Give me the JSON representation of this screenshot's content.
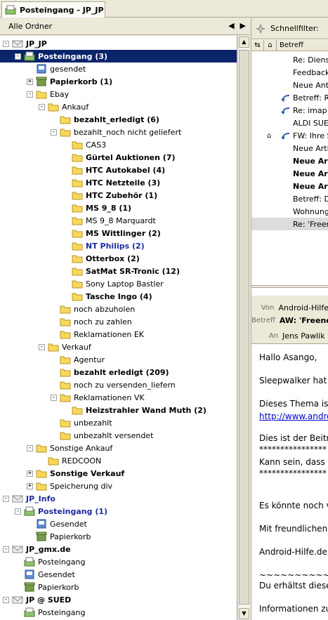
{
  "tab": {
    "title": "Posteingang - JP_JP"
  },
  "folder_pane": {
    "header": "Alle Ordner",
    "prev_arrow": "◀",
    "next_arrow": "▶"
  },
  "tree": [
    {
      "label": "JP_JP",
      "bold": true,
      "toggle": "-",
      "icon": "account-icon",
      "indent": 0
    },
    {
      "label": "Posteingang (3)",
      "bold": true,
      "toggle": "-",
      "icon": "inbox-icon",
      "indent": 1,
      "selected": true
    },
    {
      "label": "gesendet",
      "toggle": "",
      "icon": "sent-icon",
      "indent": 2
    },
    {
      "label": "Papierkorb (1)",
      "bold": true,
      "toggle": "+",
      "icon": "trash-icon",
      "indent": 2
    },
    {
      "label": "Ebay",
      "toggle": "-",
      "icon": "folder-icon",
      "indent": 2
    },
    {
      "label": "Ankauf",
      "toggle": "-",
      "icon": "folder-icon",
      "indent": 3
    },
    {
      "label": "bezahlt_erledigt (6)",
      "bold": true,
      "toggle": "",
      "icon": "folder-icon",
      "indent": 4
    },
    {
      "label": "bezahlt_noch nicht geliefert",
      "toggle": "-",
      "icon": "folder-icon",
      "indent": 4
    },
    {
      "label": "CAS3",
      "toggle": "",
      "icon": "folder-icon",
      "indent": 5
    },
    {
      "label": "Gürtel Auktionen (7)",
      "bold": true,
      "toggle": "",
      "icon": "folder-icon",
      "indent": 5
    },
    {
      "label": "HTC Autokabel (4)",
      "bold": true,
      "toggle": "",
      "icon": "folder-icon",
      "indent": 5
    },
    {
      "label": "HTC Netzteile (3)",
      "bold": true,
      "toggle": "",
      "icon": "folder-icon",
      "indent": 5
    },
    {
      "label": "HTC Zubehör (1)",
      "bold": true,
      "toggle": "",
      "icon": "folder-icon",
      "indent": 5
    },
    {
      "label": "MS 9_8 (1)",
      "bold": true,
      "toggle": "",
      "icon": "folder-icon",
      "indent": 5
    },
    {
      "label": "MS 9_8 Marquardt",
      "toggle": "",
      "icon": "folder-icon",
      "indent": 5
    },
    {
      "label": "MS Wittlinger (2)",
      "bold": true,
      "toggle": "",
      "icon": "folder-icon",
      "indent": 5
    },
    {
      "label": "NT Philips (2)",
      "bold": true,
      "blue": true,
      "toggle": "",
      "icon": "folder-icon",
      "indent": 5
    },
    {
      "label": "Otterbox (2)",
      "bold": true,
      "toggle": "",
      "icon": "folder-icon",
      "indent": 5
    },
    {
      "label": "SatMat SR-Tronic (12)",
      "bold": true,
      "toggle": "",
      "icon": "folder-icon",
      "indent": 5
    },
    {
      "label": "Sony Laptop Bastler",
      "toggle": "",
      "icon": "folder-icon",
      "indent": 5
    },
    {
      "label": "Tasche Ingo (4)",
      "bold": true,
      "toggle": "",
      "icon": "folder-icon",
      "indent": 5
    },
    {
      "label": "noch abzuholen",
      "toggle": "",
      "icon": "folder-icon",
      "indent": 4
    },
    {
      "label": "noch zu zahlen",
      "toggle": "",
      "icon": "folder-icon",
      "indent": 4
    },
    {
      "label": "Reklamationen EK",
      "toggle": "",
      "icon": "folder-icon",
      "indent": 4
    },
    {
      "label": "Verkauf",
      "toggle": "-",
      "icon": "folder-icon",
      "indent": 3
    },
    {
      "label": "Agentur",
      "toggle": "",
      "icon": "folder-icon",
      "indent": 4
    },
    {
      "label": "bezahlt erledigt (209)",
      "bold": true,
      "toggle": "",
      "icon": "folder-icon",
      "indent": 4
    },
    {
      "label": "noch zu versenden_liefern",
      "toggle": "",
      "icon": "folder-icon",
      "indent": 4
    },
    {
      "label": "Reklamationen VK",
      "toggle": "-",
      "icon": "folder-icon",
      "indent": 4
    },
    {
      "label": "Heizstrahler Wand Muth (2)",
      "bold": true,
      "toggle": "",
      "icon": "folder-icon",
      "indent": 5
    },
    {
      "label": "unbezahlt",
      "toggle": "",
      "icon": "folder-icon",
      "indent": 4
    },
    {
      "label": "unbezahlt versendet",
      "toggle": "",
      "icon": "folder-icon",
      "indent": 4
    },
    {
      "label": "Sonstige Ankauf",
      "toggle": "-",
      "icon": "folder-icon",
      "indent": 2
    },
    {
      "label": "REDCOON",
      "toggle": "",
      "icon": "folder-icon",
      "indent": 3
    },
    {
      "label": "Sonstige Verkauf",
      "bold": true,
      "toggle": "+",
      "icon": "folder-icon",
      "indent": 2
    },
    {
      "label": "Speicherung div",
      "toggle": "+",
      "icon": "folder-icon",
      "indent": 2
    },
    {
      "label": "JP_Info",
      "bold": true,
      "blue": true,
      "toggle": "-",
      "icon": "account-icon",
      "indent": 0
    },
    {
      "label": "Posteingang (1)",
      "bold": true,
      "blue": true,
      "toggle": "-",
      "icon": "inbox-icon",
      "indent": 1
    },
    {
      "label": "Gesendet",
      "toggle": "",
      "icon": "sent-icon",
      "indent": 2
    },
    {
      "label": "Papierkorb",
      "toggle": "",
      "icon": "trash-icon",
      "indent": 2
    },
    {
      "label": "JP_gmx.de",
      "bold": true,
      "toggle": "-",
      "icon": "account-icon",
      "indent": 0
    },
    {
      "label": "Posteingang",
      "toggle": "",
      "icon": "inbox-icon",
      "indent": 1
    },
    {
      "label": "Gesendet",
      "toggle": "",
      "icon": "sent-icon",
      "indent": 1
    },
    {
      "label": "Papierkorb",
      "toggle": "",
      "icon": "trash-icon",
      "indent": 1
    },
    {
      "label": "JP @ SUED",
      "bold": true,
      "toggle": "-",
      "icon": "account-icon",
      "indent": 0
    },
    {
      "label": "Posteingang",
      "toggle": "",
      "icon": "inbox-icon",
      "indent": 1
    }
  ],
  "quickfilter": {
    "label": "Schnellfilter:"
  },
  "message_list": {
    "columns": {
      "subject": "Betreff"
    },
    "messages": [
      {
        "subject": "Re: Dienst",
        "bold": false,
        "thread": false,
        "attachment": false
      },
      {
        "subject": "Feedback",
        "bold": false,
        "thread": false,
        "attachment": false
      },
      {
        "subject": "Neue Antw",
        "bold": false,
        "thread": false,
        "attachment": false
      },
      {
        "subject": "Betreff: Re",
        "bold": false,
        "thread": true,
        "attachment": false
      },
      {
        "subject": "Re: imap u",
        "bold": false,
        "thread": true,
        "attachment": false
      },
      {
        "subject": "ALDI SUED",
        "bold": false,
        "thread": false,
        "attachment": false
      },
      {
        "subject": "FW: Ihre S",
        "bold": false,
        "thread": true,
        "attachment": true
      },
      {
        "subject": "Neue Artik",
        "bold": false,
        "thread": false,
        "attachment": false
      },
      {
        "subject": "Neue Art",
        "bold": true,
        "thread": false,
        "attachment": false
      },
      {
        "subject": "Neue Art",
        "bold": true,
        "thread": false,
        "attachment": false
      },
      {
        "subject": "Neue Art",
        "bold": true,
        "thread": false,
        "attachment": false
      },
      {
        "subject": "Betreff: De",
        "bold": false,
        "thread": false,
        "attachment": false
      },
      {
        "subject": "Wohnung",
        "bold": false,
        "thread": false,
        "attachment": false
      },
      {
        "subject": "Re: 'Freen",
        "bold": false,
        "thread": false,
        "attachment": false,
        "selected": true
      }
    ]
  },
  "header": {
    "from_key": "Von",
    "from_value": "Android-Hilfe",
    "subject_key": "Betreff",
    "subject_value": "AW: 'Freene",
    "to_key": "An",
    "to_value": "Jens Pawlik"
  },
  "body": {
    "lines": [
      {
        "text": "Hallo Asango,",
        "link": false
      },
      {
        "text": "Sleepwalker hat a",
        "link": false
      },
      {
        "text": "Dieses Thema ist",
        "link": false
      },
      {
        "text": "http://www.androi",
        "link": true
      },
      {
        "text": "Dies ist der Beitra",
        "link": false
      },
      {
        "text": "****************",
        "link": false
      },
      {
        "text": "Kann sein, dass",
        "link": false
      },
      {
        "text": "****************",
        "link": false
      },
      {
        "text": "Es könnte noch v",
        "link": false
      },
      {
        "text": "Mit freundlichen G",
        "link": false
      },
      {
        "text": "Android-Hilfe.de",
        "link": false
      },
      {
        "text": "~~~~~~~~~~~~~~~~",
        "link": false
      },
      {
        "text": "Du erhältst diese",
        "link": false
      },
      {
        "text": "Informationen zur",
        "link": false
      }
    ]
  },
  "colors": {
    "selection": "#0a246a",
    "unread_blue": "#1c2ca2",
    "folder_yellow": "#f8d85a"
  }
}
